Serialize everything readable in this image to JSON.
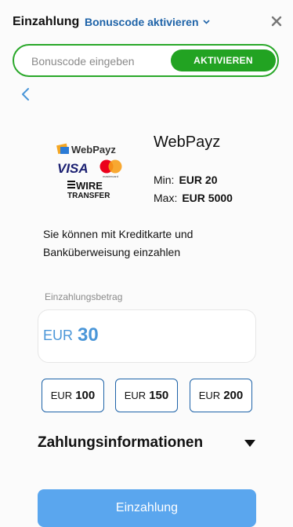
{
  "header": {
    "title": "Einzahlung",
    "bonus_link": "Bonuscode aktivieren"
  },
  "promo": {
    "placeholder": "Bonuscode eingeben",
    "button": "AKTIVIEREN"
  },
  "method": {
    "name": "WebPayz",
    "logo_text": [
      "WebPayz",
      "VISA",
      "mastercard",
      "WIRE",
      "TRANSFER"
    ],
    "min_label": "Min:",
    "min_value": "EUR 20",
    "max_label": "Max:",
    "max_value": "EUR 5000",
    "description": "Sie können mit Kreditkarte und Banküberweisung einzahlen"
  },
  "amount": {
    "label": "Einzahlungsbetrag",
    "currency": "EUR",
    "value": "30"
  },
  "quick_amounts": [
    {
      "currency": "EUR",
      "value": "100"
    },
    {
      "currency": "EUR",
      "value": "150"
    },
    {
      "currency": "EUR",
      "value": "200"
    }
  ],
  "info_section": {
    "title": "Zahlungsinformationen"
  },
  "submit": {
    "label": "Einzahlung"
  },
  "colors": {
    "accent_green": "#22a322",
    "link_blue": "#1e63a8",
    "amount_blue": "#4a96d8",
    "submit_blue": "#5aa6ee"
  }
}
